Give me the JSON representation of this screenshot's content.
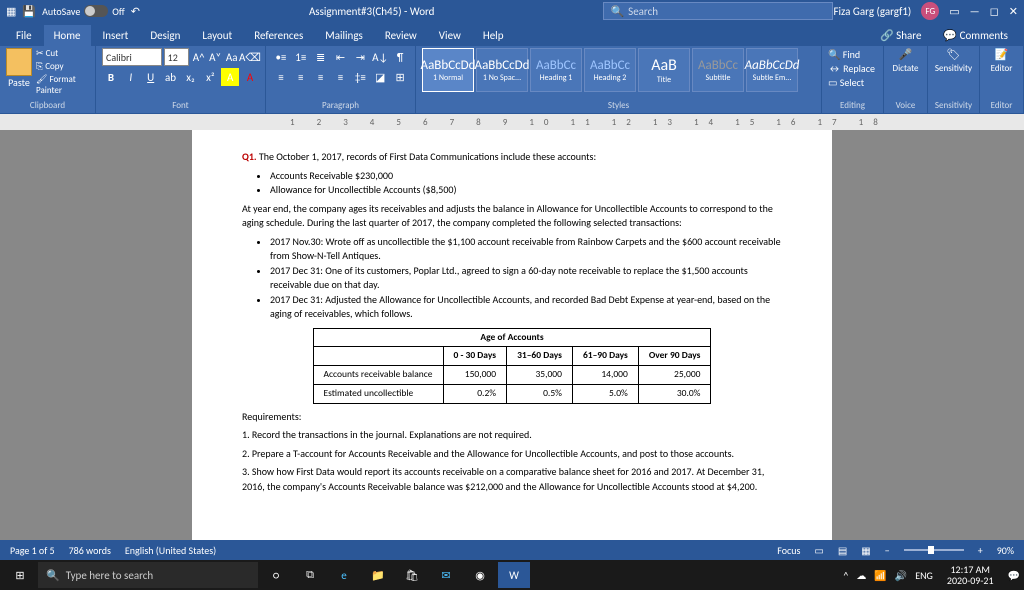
{
  "title": {
    "autosave": "AutoSave",
    "off": "Off",
    "doc": "Assignment#3(Ch45) - Word",
    "search_ph": "Search",
    "user": "Fiza Garg (gargf1)",
    "initials": "FG"
  },
  "tabs": {
    "file": "File",
    "home": "Home",
    "insert": "Insert",
    "design": "Design",
    "layout": "Layout",
    "references": "References",
    "mailings": "Mailings",
    "review": "Review",
    "view": "View",
    "help": "Help",
    "share": "Share",
    "comments": "Comments"
  },
  "ribbon": {
    "clipboard": {
      "paste": "Paste",
      "cut": "Cut",
      "copy": "Copy",
      "painter": "Format Painter",
      "label": "Clipboard"
    },
    "font": {
      "name": "Calibri",
      "size": "12",
      "label": "Font"
    },
    "paragraph": {
      "label": "Paragraph"
    },
    "styles": {
      "s1": "1 Normal",
      "s2": "1 No Spac...",
      "s3": "Heading 1",
      "s4": "Heading 2",
      "s5": "Title",
      "s6": "Subtitle",
      "s7": "Subtle Em...",
      "label": "Styles",
      "prev": "AaBbCcDd",
      "prevH": "AaBbCc",
      "prevT": "AaB"
    },
    "editing": {
      "find": "Find",
      "replace": "Replace",
      "select": "Select",
      "label": "Editing"
    },
    "voice": {
      "dictate": "Dictate",
      "label": "Voice"
    },
    "sens": {
      "btn": "Sensitivity",
      "label": "Sensitivity"
    },
    "editor": {
      "btn": "Editor",
      "label": "Editor"
    }
  },
  "doc": {
    "q1": "Q1.",
    "q1t": " The October 1, 2017, records of First Data Communications include these accounts:",
    "b1": "Accounts Receivable $230,000",
    "b2": "Allowance for Uncollectible Accounts ($8,500)",
    "p1": "At year end, the company ages its receivables and adjusts the balance in Allowance for Uncollectible Accounts to correspond to the aging schedule. During the last quarter of 2017, the company completed the following selected transactions:",
    "c1": "2017 Nov.30: Wrote off as uncollectible the $1,100 account receivable from Rainbow Carpets and the $600 account receivable from Show-N-Tell Antiques.",
    "c2": "2017 Dec 31: One of its customers, Poplar Ltd., agreed to sign a 60-day note receivable to replace the $1,500 accounts receivable due on that day.",
    "c3": "2017 Dec 31: Adjusted the Allowance for Uncollectible Accounts, and recorded Bad Debt Expense at year-end, based on the aging of receivables, which follows.",
    "th0": "Age of Accounts",
    "th1": "0 - 30 Days",
    "th2": "31–60 Days",
    "th3": "61–90 Days",
    "th4": "Over 90 Days",
    "r1": "Accounts receivable balance",
    "r1a": "150,000",
    "r1b": "35,000",
    "r1c": "14,000",
    "r1d": "25,000",
    "r2": "Estimated uncollectible",
    "r2a": "0.2%",
    "r2b": "0.5%",
    "r2c": "5.0%",
    "r2d": "30.0%",
    "req": "Requirements:",
    "rq1": "1. Record the transactions in the journal. Explanations are not required.",
    "rq2": "2. Prepare a T-account for Accounts Receivable and the Allowance for Uncollectible Accounts, and post to those accounts.",
    "rq3": "3. Show how First Data would report its accounts receivable on a comparative balance sheet for 2016 and 2017. At December 31, 2016, the company's Accounts Receivable balance was $212,000 and the Allowance for Uncollectible Accounts stood at $4,200."
  },
  "status": {
    "page": "Page 1 of 5",
    "words": "786 words",
    "lang": "English (United States)",
    "focus": "Focus",
    "zoom": "90%"
  },
  "taskbar": {
    "search": "Type here to search",
    "lang": "ENG",
    "time": "12:17 AM",
    "date": "2020-09-21"
  }
}
